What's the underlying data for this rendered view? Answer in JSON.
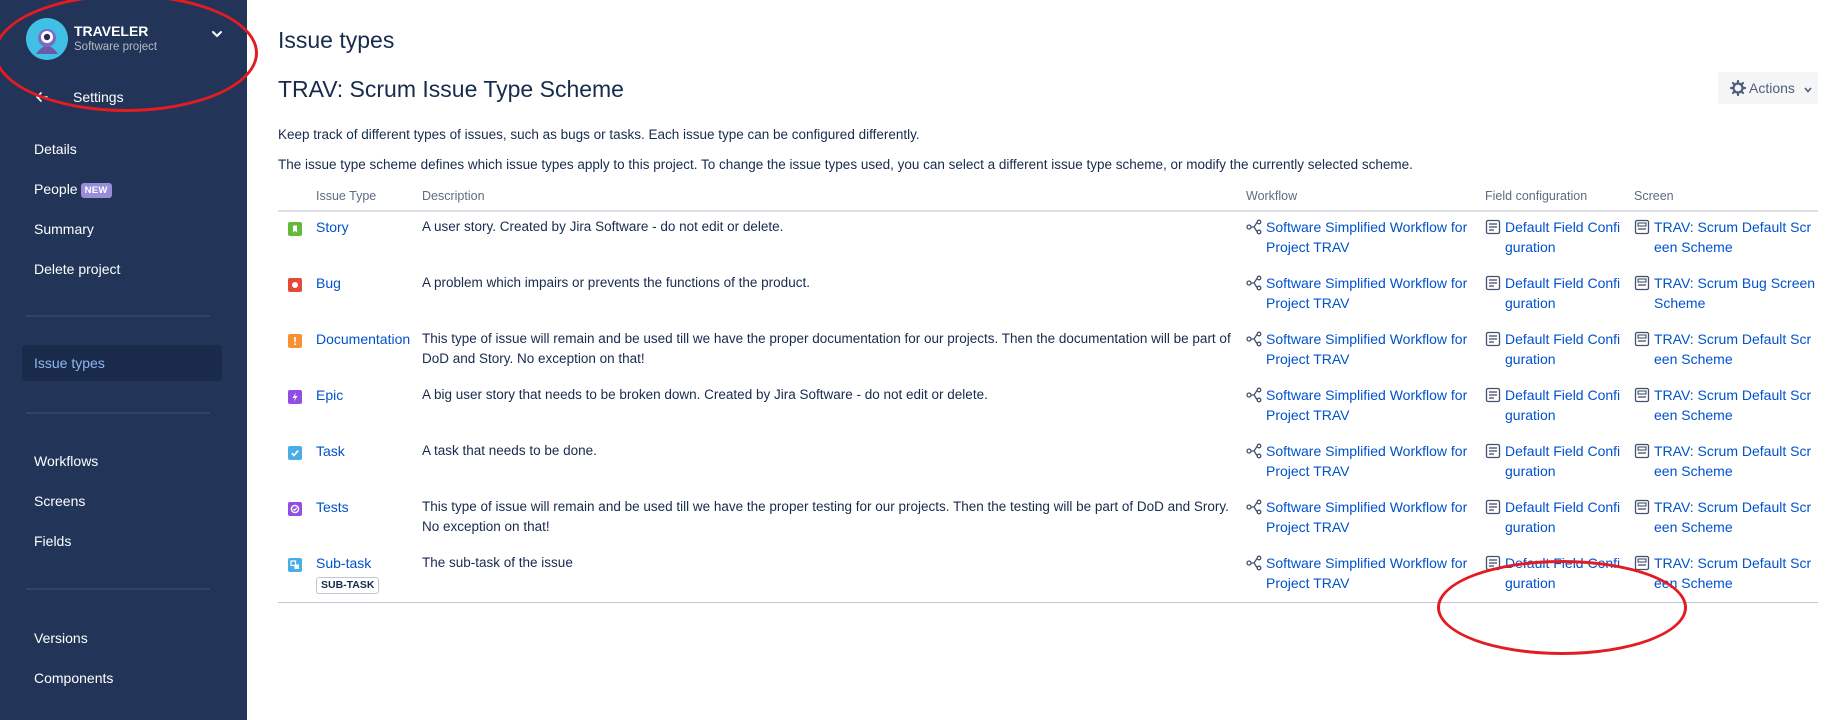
{
  "sidebar": {
    "project_name": "TRAVELER",
    "project_type": "Software project",
    "back_label": "Settings",
    "items_group1": [
      {
        "label": "Details"
      },
      {
        "label": "People",
        "badge": "NEW"
      },
      {
        "label": "Summary"
      },
      {
        "label": "Delete project"
      }
    ],
    "active_item": "Issue types",
    "items_group2": [
      {
        "label": "Workflows"
      },
      {
        "label": "Screens"
      },
      {
        "label": "Fields"
      }
    ],
    "items_group3": [
      {
        "label": "Versions"
      },
      {
        "label": "Components"
      }
    ]
  },
  "main": {
    "page_title": "Issue types",
    "scheme_title": "TRAV: Scrum Issue Type Scheme",
    "actions_label": "Actions",
    "description_1": "Keep track of different types of issues, such as bugs or tasks. Each issue type can be configured differently.",
    "description_2": "The issue type scheme defines which issue types apply to this project. To change the issue types used, you can select a different issue type scheme, or modify the currently selected scheme."
  },
  "table": {
    "headers": {
      "issue_type": "Issue Type",
      "description": "Description",
      "workflow": "Workflow",
      "field_config": "Field configuration",
      "screen": "Screen"
    },
    "rows": [
      {
        "name": "Story",
        "icon": "story-icon",
        "color": "#63ba3c",
        "description": "A user story. Created by Jira Software - do not edit or delete.",
        "workflow": "Software Simplified Workflow for Project TRAV",
        "field_config": "Default Field Configuration",
        "screen": "TRAV: Scrum Default Screen Scheme"
      },
      {
        "name": "Bug",
        "icon": "bug-icon",
        "color": "#e5493a",
        "description": "A problem which impairs or prevents the functions of the product.",
        "workflow": "Software Simplified Workflow for Project TRAV",
        "field_config": "Default Field Configuration",
        "screen": "TRAV: Scrum Bug Screen Scheme"
      },
      {
        "name": "Documentation",
        "icon": "documentation-icon",
        "color": "#f79232",
        "description": "This type of issue will remain and be used till we have the proper documentation for our projects. Then the documentation will be part of DoD and Story. No exception on that!",
        "workflow": "Software Simplified Workflow for Project TRAV",
        "field_config": "Default Field Configuration",
        "screen": "TRAV: Scrum Default Screen Scheme"
      },
      {
        "name": "Epic",
        "icon": "epic-icon",
        "color": "#904ee2",
        "description": "A big user story that needs to be broken down. Created by Jira Software - do not edit or delete.",
        "workflow": "Software Simplified Workflow for Project TRAV",
        "field_config": "Default Field Configuration",
        "screen": "TRAV: Scrum Default Screen Scheme"
      },
      {
        "name": "Task",
        "icon": "task-icon",
        "color": "#4bade8",
        "description": "A task that needs to be done.",
        "workflow": "Software Simplified Workflow for Project TRAV",
        "field_config": "Default Field Configuration",
        "screen": "TRAV: Scrum Default Screen Scheme"
      },
      {
        "name": "Tests",
        "icon": "tests-icon",
        "color": "#904ee2",
        "description": "This type of issue will remain and be used till we have the proper testing for our projects. Then the testing will be part of DoD and Srory. No exception on that!",
        "workflow": "Software Simplified Workflow for Project TRAV",
        "field_config": "Default Field Configuration",
        "screen": "TRAV: Scrum Default Screen Scheme"
      },
      {
        "name": "Sub-task",
        "icon": "subtask-icon",
        "color": "#4bade8",
        "badge": "SUB-TASK",
        "description": "The sub-task of the issue",
        "workflow": "Software Simplified Workflow for Project TRAV",
        "field_config": "Default Field Configuration",
        "screen": "TRAV: Scrum Default Screen Scheme"
      }
    ]
  },
  "colors": {
    "sidebar_bg": "#223458",
    "link": "#0052cc",
    "annotation_circle": "#e31b23"
  }
}
